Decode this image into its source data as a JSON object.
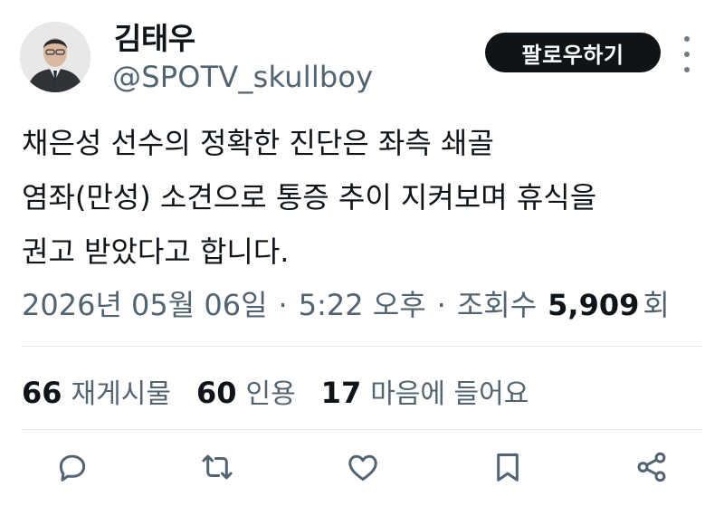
{
  "author": {
    "display_name": "김태우",
    "handle": "@SPOTV_skullboy"
  },
  "follow_button": {
    "label": "팔로우하기"
  },
  "tweet": {
    "lines": [
      "채은성 선수의 정확한 진단은 좌측 쇄골",
      "염좌(만성) 소견으로 통증 추이 지켜보며 휴식을",
      "권고 받았다고 합니다."
    ]
  },
  "meta": {
    "date": "2026년 05월 06일",
    "separator": "·",
    "time": "5:22 오후",
    "views_label_prefix": "조회수",
    "views_count": "5,909",
    "views_label_suffix": "회"
  },
  "stats": {
    "reposts": {
      "count": "66",
      "label": "재게시물"
    },
    "quotes": {
      "count": "60",
      "label": "인용"
    },
    "likes": {
      "count": "17",
      "label": "마음에 들어요"
    }
  },
  "actions": [
    {
      "icon": "reply-icon"
    },
    {
      "icon": "repost-icon"
    },
    {
      "icon": "like-icon"
    },
    {
      "icon": "bookmark-icon"
    },
    {
      "icon": "share-icon"
    }
  ],
  "colors": {
    "text_primary": "#0f1419",
    "text_secondary": "#536471",
    "follow_bg": "#0f1419",
    "divider": "#e6e9ec"
  }
}
